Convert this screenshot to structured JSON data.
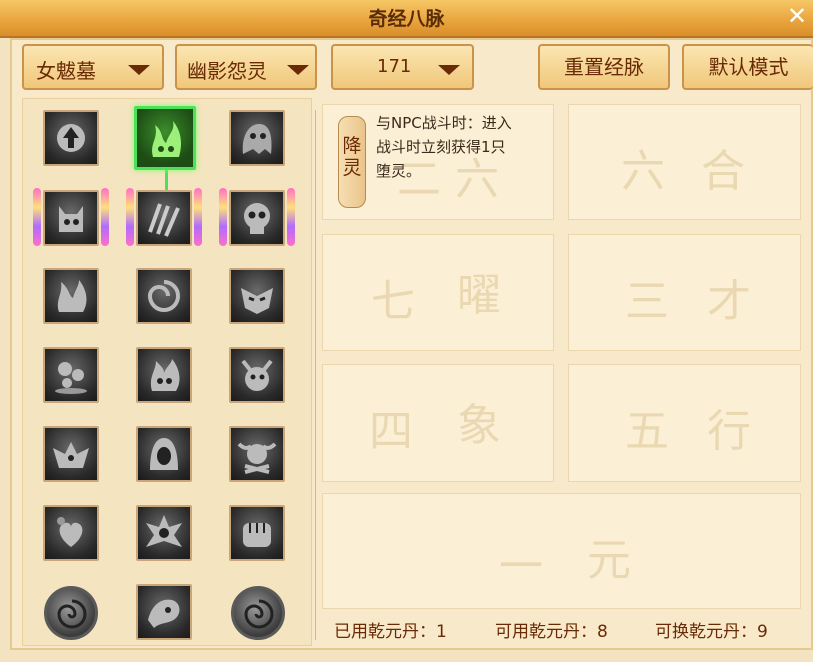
{
  "window": {
    "title": "奇经八脉",
    "close_glyph": "✕"
  },
  "toolbar": {
    "sect": "女魃墓",
    "school": "幽影怨灵",
    "level": "171",
    "reset_label": "重置经脉",
    "default_label": "默认模式"
  },
  "skill": {
    "name": "降灵",
    "desc_lines": [
      "与NPC战斗时：进入",
      "战斗时立刻获得1只",
      "堕灵。"
    ]
  },
  "watermarks": [
    "二",
    "六",
    "合",
    "七",
    "曜",
    "三",
    "才",
    "四",
    "象",
    "五",
    "行",
    "一",
    "元"
  ],
  "stats": {
    "used": "已用乾元丹：1",
    "available": "可用乾元丹：8",
    "exchangeable": "可换乾元丹：9"
  },
  "icons": {
    "row1": [
      "arrow-up-icon",
      "green-flame-icon",
      "ghost-icon"
    ],
    "row2": [
      "demon-icon",
      "claw-icon",
      "skull-icon"
    ],
    "row3": [
      "fire-icon",
      "swirl-icon",
      "mask-icon"
    ],
    "row4": [
      "orbs-icon",
      "flame-face-icon",
      "horned-icon"
    ],
    "row5": [
      "winged-demon-icon",
      "hooded-icon",
      "bull-skull-icon"
    ],
    "row6": [
      "heart-orb-icon",
      "spiked-icon",
      "fist-icon"
    ],
    "row7": [
      "spiral-coin-icon",
      "phantom-icon",
      "spiral-coin-icon"
    ]
  }
}
